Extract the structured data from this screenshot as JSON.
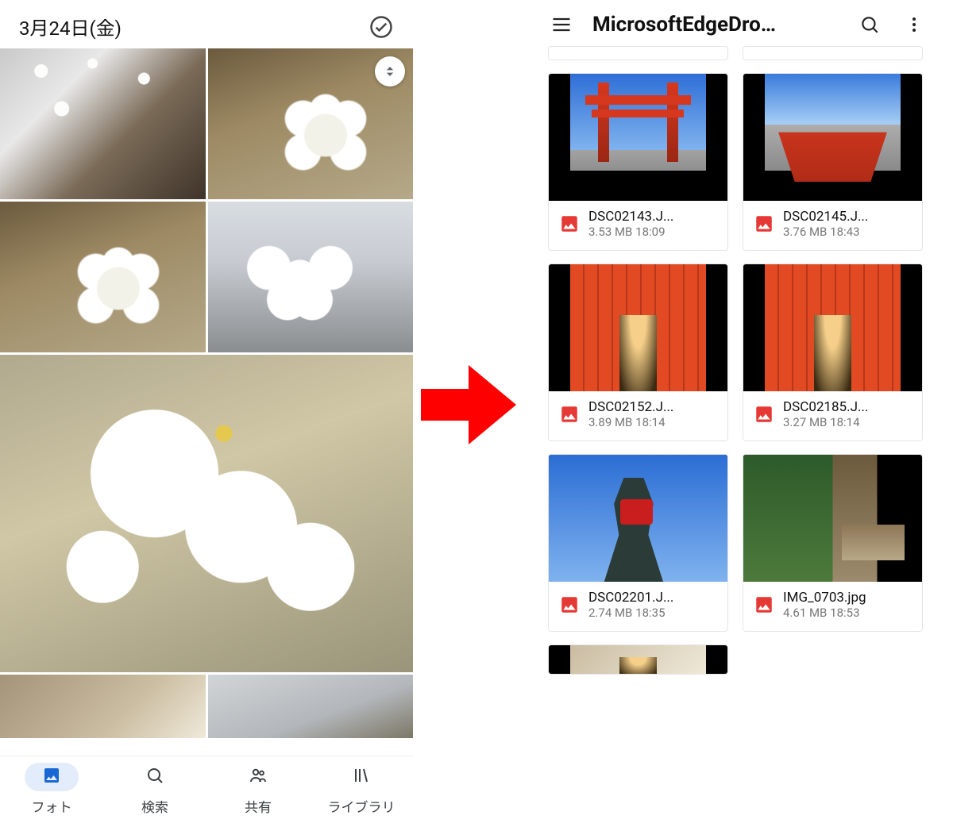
{
  "colors": {
    "accent": "#1967d2",
    "arrow": "#ff0000",
    "fileIcon": "#e53935"
  },
  "left": {
    "date": "3月24日(金)",
    "nav": [
      {
        "id": "photos",
        "label": "フォト",
        "active": true
      },
      {
        "id": "search",
        "label": "検索",
        "active": false
      },
      {
        "id": "sharing",
        "label": "共有",
        "active": false
      },
      {
        "id": "library",
        "label": "ライブラリ",
        "active": false
      }
    ]
  },
  "right": {
    "title": "MicrosoftEdgeDro…",
    "files": [
      {
        "name": "DSC02143.J...",
        "size": "3.53 MB",
        "time": "18:09",
        "thumb": "torii-gate"
      },
      {
        "name": "DSC02145.J...",
        "size": "3.76 MB",
        "time": "18:43",
        "thumb": "torii-building"
      },
      {
        "name": "DSC02152.J...",
        "size": "3.89 MB",
        "time": "18:14",
        "thumb": "torii-tunnel"
      },
      {
        "name": "DSC02185.J...",
        "size": "3.27 MB",
        "time": "18:14",
        "thumb": "torii-tunnel"
      },
      {
        "name": "DSC02201.J...",
        "size": "2.74 MB",
        "time": "18:35",
        "thumb": "fox"
      },
      {
        "name": "IMG_0703.jpg",
        "size": "4.61 MB",
        "time": "18:53",
        "thumb": "garden"
      }
    ]
  }
}
